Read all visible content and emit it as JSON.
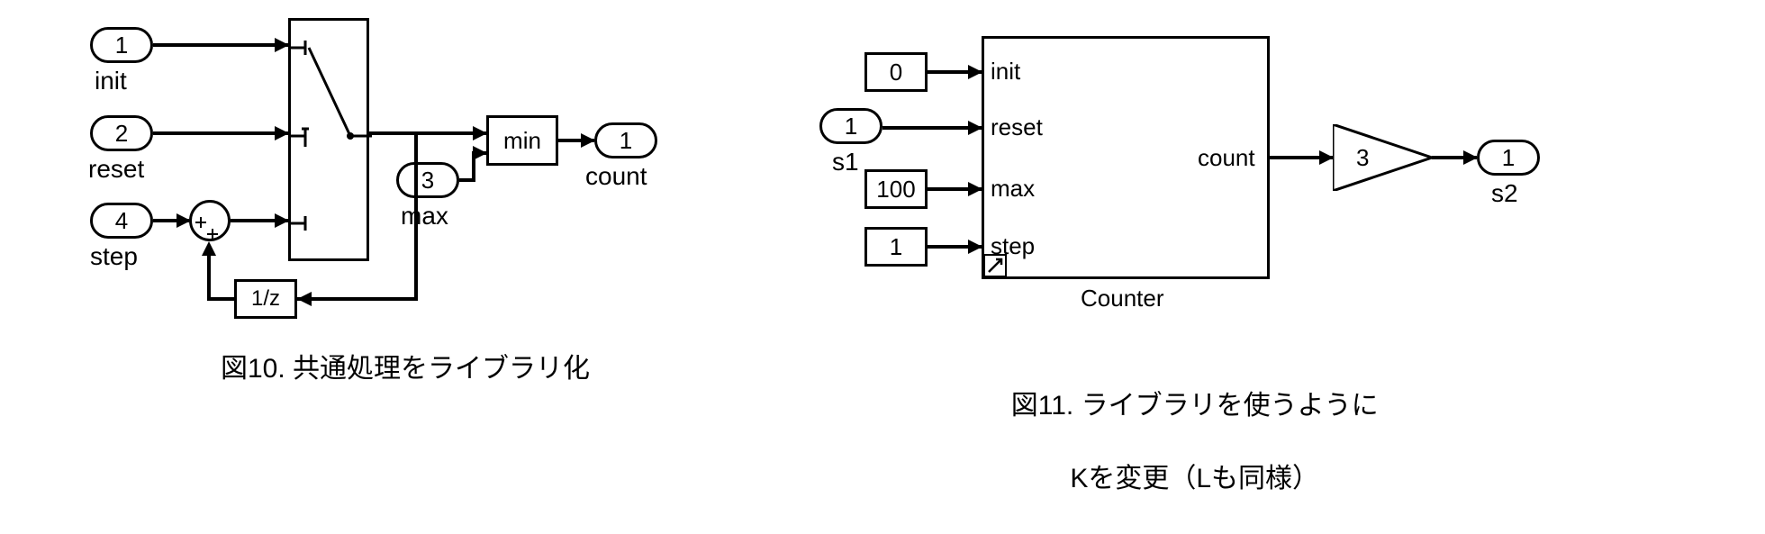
{
  "fig10": {
    "caption": "図10. 共通処理をライブラリ化",
    "ports_in": {
      "p1": {
        "num": "1",
        "label": "init"
      },
      "p2": {
        "num": "2",
        "label": "reset"
      },
      "p3": {
        "num": "3",
        "label": "max"
      },
      "p4": {
        "num": "4",
        "label": "step"
      }
    },
    "ports_out": {
      "p1": {
        "num": "1",
        "label": "count"
      }
    },
    "delay_label": "1/z",
    "min_label": "min"
  },
  "fig11": {
    "caption_line1": "図11. ライブラリを使うように",
    "caption_line2": "Kを変更（Lも同様）",
    "const_init": "0",
    "const_max": "100",
    "const_step": "1",
    "in_port": {
      "num": "1",
      "label": "s1"
    },
    "out_port": {
      "num": "1",
      "label": "s2"
    },
    "subsystem_name": "Counter",
    "sub_in_labels": {
      "init": "init",
      "reset": "reset",
      "max": "max",
      "step": "step"
    },
    "sub_out_label": "count",
    "gain_value": "3"
  }
}
